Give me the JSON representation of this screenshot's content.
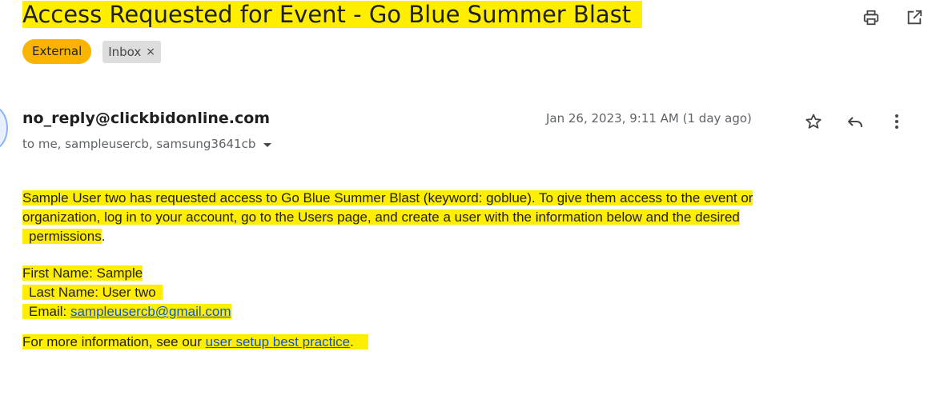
{
  "email": {
    "subject": "Access Requested for Event - Go Blue Summer Blast",
    "labels": {
      "external": "External",
      "inbox": "Inbox",
      "inbox_remove": "×"
    },
    "sender": "no_reply@clickbidonline.com",
    "recipients": "to me, sampleusercb, samsung3641cb",
    "date": "Jan 26, 2023, 9:11 AM (1 day ago)",
    "body": {
      "paragraph_line1": "Sample User two has requested access to Go Blue Summer Blast (keyword: goblue). To give them access to the event or",
      "paragraph_line2": "organization, log in to your account, go to the Users page, and create a user with the information below and the desired",
      "paragraph_line3": "permissions",
      "paragraph_end": ".",
      "first_name": "First Name: Sample",
      "last_name": "Last Name: User two",
      "email_label": "Email: ",
      "email_link": "sampleusercb@gmail.com",
      "more_prefix": "For more information, see our ",
      "more_link": "user setup best practice",
      "more_suffix": "."
    }
  },
  "icons": {
    "print": "print-icon",
    "open_new_window": "open-in-new-window-icon",
    "star": "star-icon",
    "reply": "reply-icon",
    "more": "more-vert-icon",
    "recipients_dropdown": "caret-down-icon"
  },
  "colors": {
    "highlight": "#ffee00",
    "external_label": "#f9b400",
    "inbox_label": "#dddddd",
    "link": "#1155cc"
  }
}
